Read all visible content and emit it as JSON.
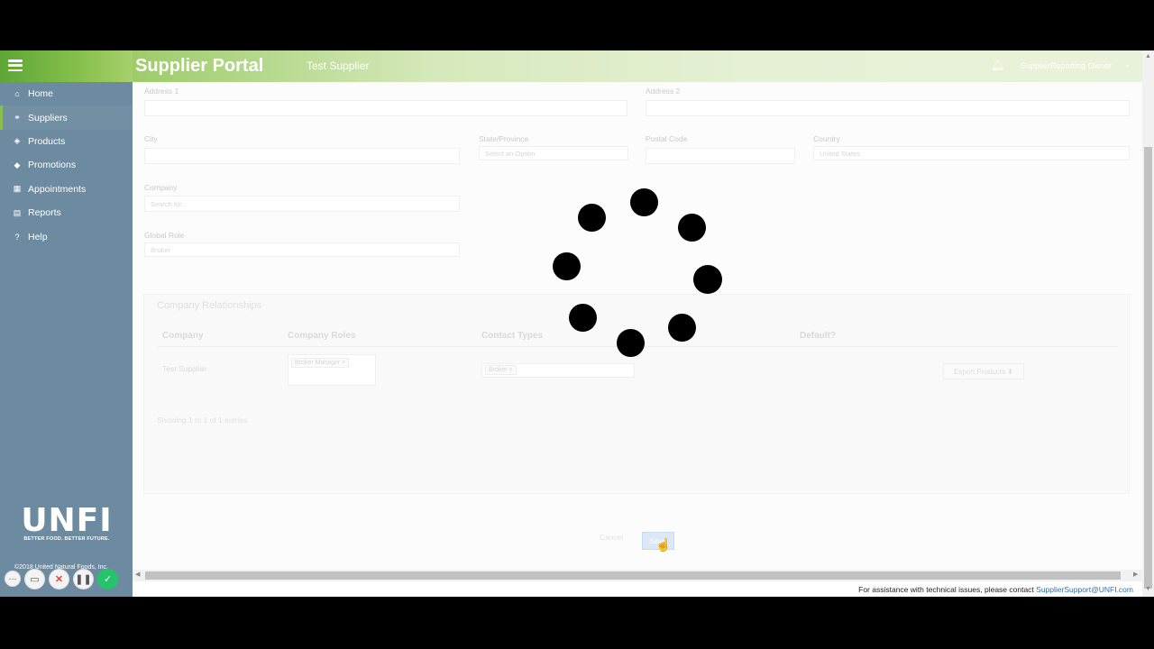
{
  "sidebar": {
    "items": [
      {
        "label": "Home",
        "icon": "home-icon",
        "glyph": "⌂"
      },
      {
        "label": "Suppliers",
        "icon": "suppliers-icon",
        "glyph": "⚭"
      },
      {
        "label": "Products",
        "icon": "products-icon",
        "glyph": "◈"
      },
      {
        "label": "Promotions",
        "icon": "tag-icon",
        "glyph": "◆"
      },
      {
        "label": "Appointments",
        "icon": "calendar-icon",
        "glyph": "▦"
      },
      {
        "label": "Reports",
        "icon": "report-icon",
        "glyph": "▤"
      },
      {
        "label": "Help",
        "icon": "help-icon",
        "glyph": "?"
      }
    ],
    "active": "Suppliers",
    "logo": "UNFI",
    "logo_tagline": "BETTER FOOD. BETTER FUTURE.",
    "copyright": "©2018 United Natural Foods, Inc."
  },
  "header": {
    "title": "Supplier Portal",
    "supplier": "Test Supplier",
    "user": "SupplierReporting Owner"
  },
  "form": {
    "address1_label": "Address 1",
    "address2_label": "Address 2",
    "city_label": "City",
    "state_label": "State/Province",
    "state_placeholder": "Select an Option",
    "postal_label": "Postal Code",
    "country_label": "Country",
    "country_value": "United States",
    "company_label": "Company",
    "company_placeholder": "Search for...",
    "global_role_label": "Global Role",
    "global_role_value": "Broker"
  },
  "relationships": {
    "title": "Company Relationships",
    "columns": [
      "Company",
      "Company Roles",
      "Contact Types",
      "Default?"
    ],
    "rows": [
      {
        "company": "Test Supplier",
        "role_chip": "Broker Manager ×",
        "contact_chip": "Broker ×",
        "export_label": "Export Products ⬇"
      }
    ],
    "showing": "Showing 1 to 1 of 1 entries"
  },
  "actions": {
    "cancel": "Cancel",
    "save": "Save"
  },
  "footer": {
    "text": "For assistance with technical issues, please contact ",
    "email": "SupplierSupport@UNFI.com"
  },
  "colors": {
    "sidebar_bg": "#6c8aa0",
    "brand_green": "#86c04b",
    "link_blue": "#2a6fb4"
  }
}
